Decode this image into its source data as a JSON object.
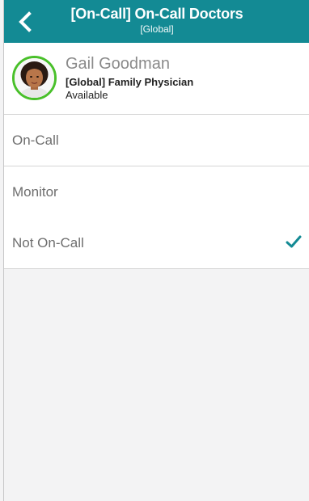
{
  "header": {
    "title": "[On-Call] On-Call Doctors",
    "subtitle": "[Global]",
    "back_icon": "chevron-left-icon",
    "color": "#138a94"
  },
  "profile": {
    "name": "Gail Goodman",
    "role": "[Global] Family Physician",
    "status": "Available",
    "avatar_ring_color": "#49c02a"
  },
  "options": [
    {
      "label": "On-Call",
      "selected": false
    },
    {
      "label": "Monitor",
      "selected": false
    },
    {
      "label": "Not On-Call",
      "selected": true
    }
  ],
  "check_icon": "checkmark-icon",
  "check_color": "#138a94"
}
